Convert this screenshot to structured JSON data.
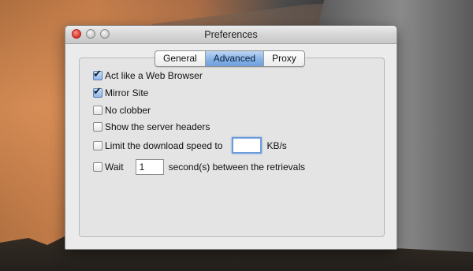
{
  "window": {
    "title": "Preferences"
  },
  "tabs": [
    {
      "label": "General",
      "active": false
    },
    {
      "label": "Advanced",
      "active": true
    },
    {
      "label": "Proxy",
      "active": false
    }
  ],
  "options": {
    "act_like_browser": {
      "label": "Act like a Web Browser",
      "checked": true
    },
    "mirror_site": {
      "label": "Mirror Site",
      "checked": true
    },
    "no_clobber": {
      "label": "No clobber",
      "checked": false
    },
    "show_headers": {
      "label": "Show the server headers",
      "checked": false
    },
    "limit_speed": {
      "label": "Limit the download speed to",
      "checked": false,
      "value": "",
      "unit": "KB/s"
    },
    "wait": {
      "label": "Wait",
      "checked": false,
      "value": "1",
      "suffix": "second(s) between the retrievals"
    }
  },
  "icons": {
    "check": "checkmark-icon",
    "close": "close-button-icon",
    "minimize": "minimize-button-icon",
    "zoom": "zoom-button-icon"
  },
  "colors": {
    "close_red": "#d8322a",
    "tab_active": "#87b2e6",
    "focus_ring": "#6c9bd9"
  }
}
